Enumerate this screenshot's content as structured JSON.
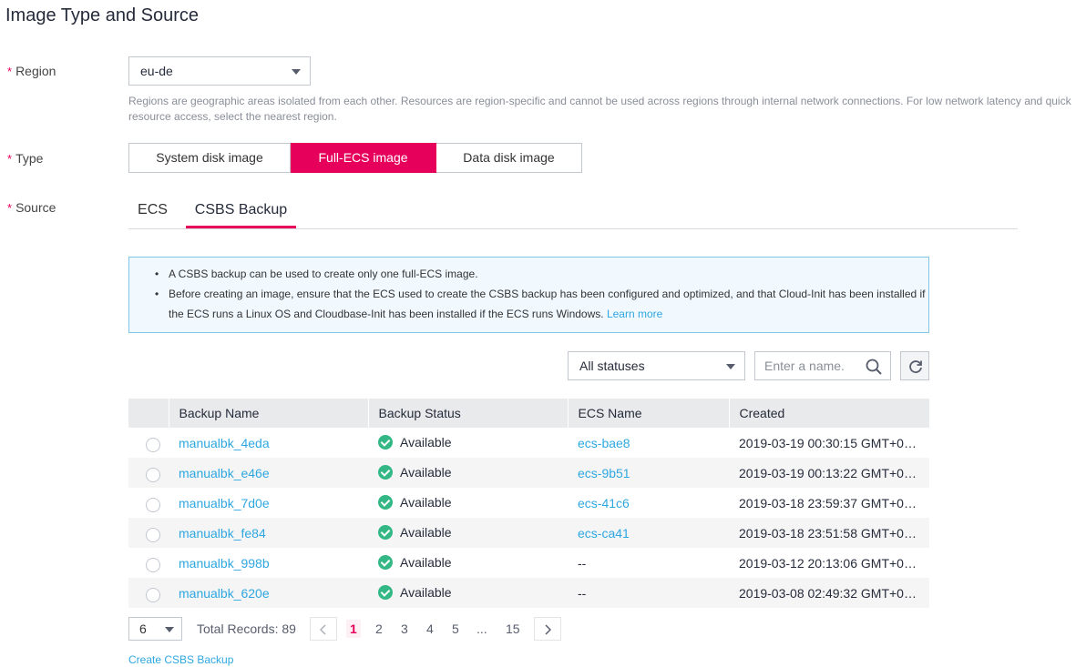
{
  "section_title": "Image Type and Source",
  "region": {
    "label": "Region",
    "required_mark": "*",
    "value": "eu-de",
    "help": "Regions are geographic areas isolated from each other. Resources are region-specific and cannot be used across regions through internal network connections. For low network latency and quick resource access, select the nearest region."
  },
  "type": {
    "label": "Type",
    "required_mark": "*",
    "options": [
      "System disk image",
      "Full-ECS image",
      "Data disk image"
    ],
    "selected": "Full-ECS image"
  },
  "source": {
    "label": "Source",
    "required_mark": "*",
    "tabs": [
      "ECS",
      "CSBS Backup"
    ],
    "active_tab": "CSBS Backup"
  },
  "info": {
    "bullet1": "A CSBS backup can be used to create only one full-ECS image.",
    "bullet2": "Before creating an image, ensure that the ECS used to create the CSBS backup has been configured and optimized, and that Cloud-Init has been installed if the ECS runs a Linux OS and Cloudbase-Init has been installed if the ECS runs Windows.",
    "learn_more": "Learn more"
  },
  "filter": {
    "status_value": "All statuses",
    "search_placeholder": "Enter a name."
  },
  "table": {
    "headers": [
      "Backup Name",
      "Backup Status",
      "ECS Name",
      "Created"
    ],
    "rows": [
      {
        "name": "manualbk_4eda",
        "status": "Available",
        "ecs": "ecs-bae8",
        "created": "2019-03-19 00:30:15 GMT+0…"
      },
      {
        "name": "manualbk_e46e",
        "status": "Available",
        "ecs": "ecs-9b51",
        "created": "2019-03-19 00:13:22 GMT+0…"
      },
      {
        "name": "manualbk_7d0e",
        "status": "Available",
        "ecs": "ecs-41c6",
        "created": "2019-03-18 23:59:37 GMT+0…"
      },
      {
        "name": "manualbk_fe84",
        "status": "Available",
        "ecs": "ecs-ca41",
        "created": "2019-03-18 23:51:58 GMT+0…"
      },
      {
        "name": "manualbk_998b",
        "status": "Available",
        "ecs": "--",
        "created": "2019-03-12 20:13:06 GMT+0…"
      },
      {
        "name": "manualbk_620e",
        "status": "Available",
        "ecs": "--",
        "created": "2019-03-08 02:49:32 GMT+0…"
      }
    ]
  },
  "pagination": {
    "page_size": "6",
    "total": "Total Records: 89",
    "pages": [
      "1",
      "2",
      "3",
      "4",
      "5",
      "...",
      "15"
    ],
    "current": "1"
  },
  "create_link": "Create CSBS Backup",
  "colors": {
    "accent": "#e6005c",
    "link": "#2ea7e0",
    "success": "#33b885"
  }
}
